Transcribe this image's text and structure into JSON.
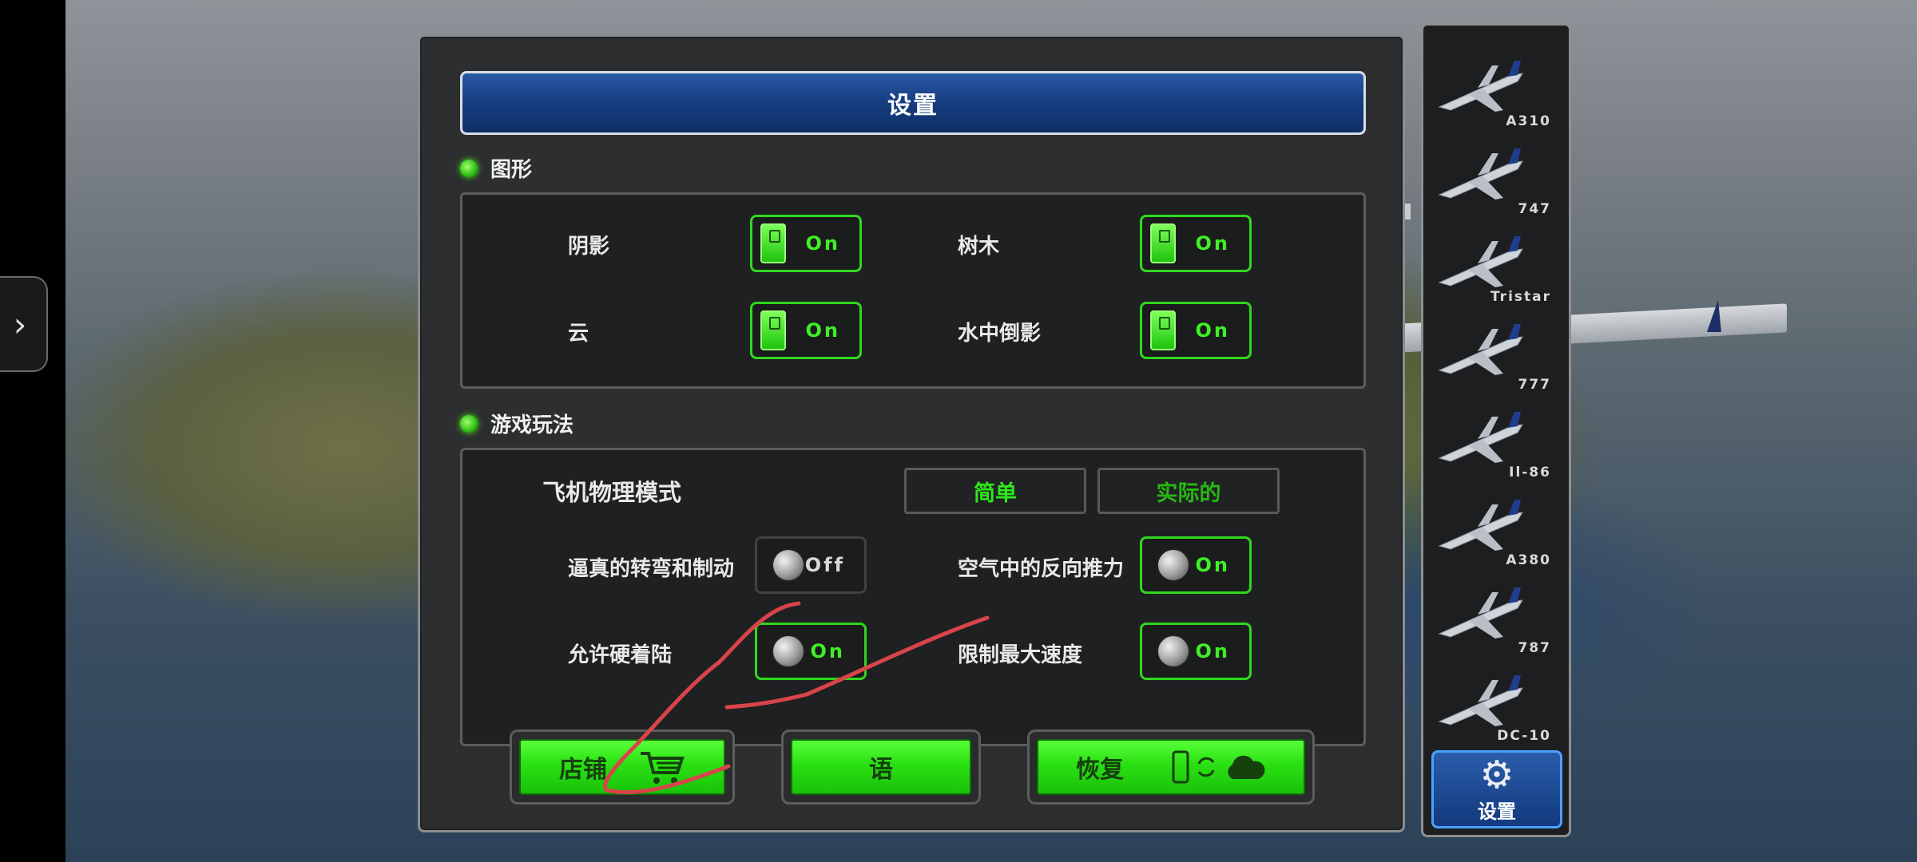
{
  "panel": {
    "title": "设置",
    "graphics": {
      "heading": "图形",
      "items": [
        {
          "label": "阴影",
          "state": "On"
        },
        {
          "label": "树木",
          "state": "On"
        },
        {
          "label": "云",
          "state": "On"
        },
        {
          "label": "水中倒影",
          "state": "On"
        }
      ]
    },
    "gameplay": {
      "heading": "游戏玩法",
      "physics_label": "飞机物理模式",
      "physics_options": [
        "简单",
        "实际的"
      ],
      "items": [
        {
          "label": "逼真的转弯和制动",
          "state": "Off"
        },
        {
          "label": "空气中的反向推力",
          "state": "On"
        },
        {
          "label": "允许硬着陆",
          "state": "On"
        },
        {
          "label": "限制最大速度",
          "state": "On"
        }
      ]
    },
    "buttons": {
      "shop": "店铺",
      "language": "语",
      "restore": "恢复"
    }
  },
  "aircraft": [
    "A310",
    "747",
    "Tristar",
    "777",
    "Il-86",
    "A380",
    "787",
    "DC-10"
  ],
  "settings_tab_label": "设置",
  "colors": {
    "accent_green": "#2fd81e",
    "title_blue": "#173f83",
    "panel_bg": "#2d2e2f"
  },
  "icons": [
    "chevron-right-icon",
    "shopping-cart-icon",
    "phone-icon",
    "sync-icon",
    "cloud-icon",
    "gear-icon",
    "airplane-icon"
  ]
}
